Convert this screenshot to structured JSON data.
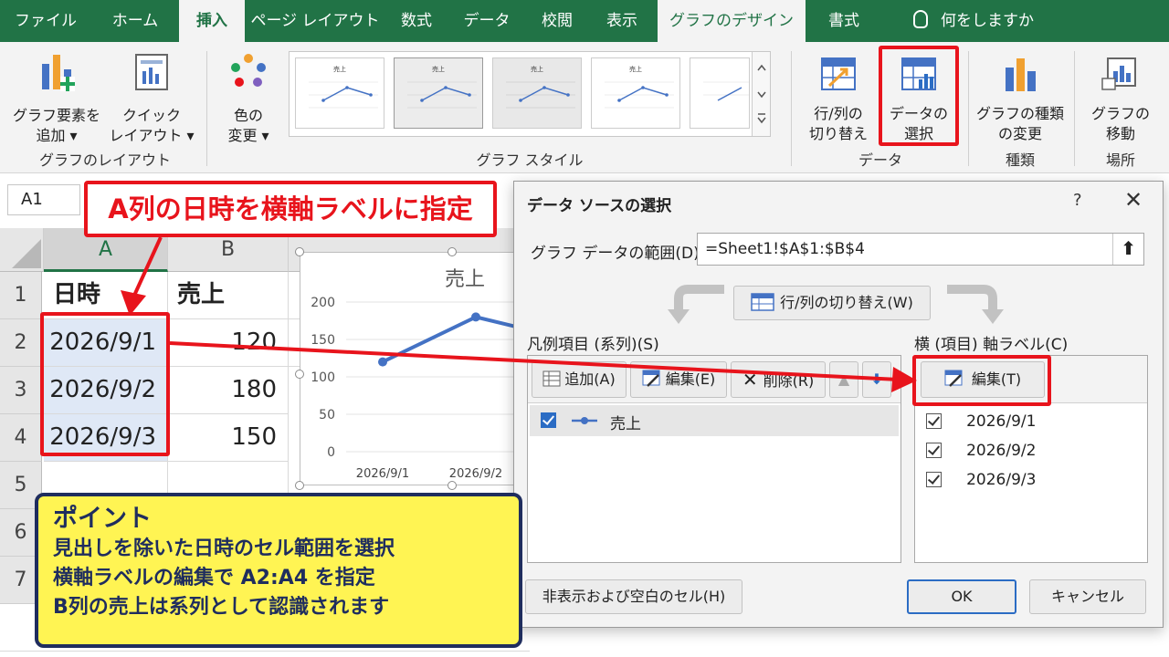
{
  "ribbon": {
    "tabs": [
      "ファイル",
      "ホーム",
      "挿入",
      "ページ レイアウト",
      "数式",
      "データ",
      "校閲",
      "表示",
      "グラフのデザイン",
      "書式"
    ],
    "active_tab": "挿入",
    "tellme": "何をしますか",
    "groups": {
      "layout": {
        "label": "グラフのレイアウト",
        "add_element": [
          "グラフ要素を",
          "追加 ▾"
        ],
        "quick_layout": [
          "クイック",
          "レイアウト ▾"
        ]
      },
      "styles": {
        "label": "グラフ スタイル",
        "change_colors": [
          "色の",
          "変更 ▾"
        ],
        "thumb_title": "売上"
      },
      "data": {
        "label": "データ",
        "switch": [
          "行/列の",
          "切り替え"
        ],
        "select": [
          "データの",
          "選択"
        ]
      },
      "type": {
        "label": "種類",
        "change": [
          "グラフの種類",
          "の変更"
        ]
      },
      "location": {
        "label": "場所",
        "move": [
          "グラフの",
          "移動"
        ]
      }
    }
  },
  "namebox": "A1",
  "sheet": {
    "columns": [
      "A",
      "B"
    ],
    "rows": [
      "1",
      "2",
      "3",
      "4",
      "5",
      "6",
      "7"
    ],
    "header": [
      "日時",
      "売上"
    ],
    "data": [
      [
        "2026/9/1",
        "120"
      ],
      [
        "2026/9/2",
        "180"
      ],
      [
        "2026/9/3",
        "150"
      ]
    ]
  },
  "chart_data": {
    "type": "line",
    "title": "売上",
    "categories": [
      "2026/9/1",
      "2026/9/2",
      "2026/9/3"
    ],
    "series": [
      {
        "name": "売上",
        "values": [
          120,
          180,
          150
        ],
        "color": "#4472c4"
      }
    ],
    "ylim": [
      0,
      200
    ],
    "yticks": [
      "0",
      "50",
      "100",
      "150",
      "200"
    ],
    "visible_xticks": [
      "2026/9/1",
      "2026/9/2"
    ]
  },
  "callout": "A列の日時を横軸ラベルに指定",
  "point": {
    "title": "ポイント",
    "lines": [
      "見出しを除いた日時のセル範囲を選択",
      "横軸ラベルの編集で A2:A4 を指定",
      "B列の売上は系列として認識されます"
    ]
  },
  "dialog": {
    "title": "データ ソースの選択",
    "help": "?",
    "close": "✕",
    "range_label": "グラフ データの範囲(D):",
    "range_value": "=Sheet1!$A$1:$B$4",
    "switch_button": "行/列の切り替え(W)",
    "legend_label": "凡例項目 (系列)(S)",
    "add_button": "追加(A)",
    "edit_button": "編集(E)",
    "delete_button": "削除(R)",
    "series_items": [
      "売上"
    ],
    "axis_label": "横 (項目) 軸ラベル(C)",
    "axis_edit_button": "編集(T)",
    "axis_items": [
      "2026/9/1",
      "2026/9/2",
      "2026/9/3"
    ],
    "hidden_cells_button": "非表示および空白のセル(H)",
    "ok_button": "OK",
    "cancel_button": "キャンセル"
  },
  "colors": {
    "excel_green": "#217346",
    "annotation_red": "#e8141c",
    "series_blue": "#4472c4",
    "point_yellow": "#fff453",
    "point_navy": "#1f2d5e"
  }
}
